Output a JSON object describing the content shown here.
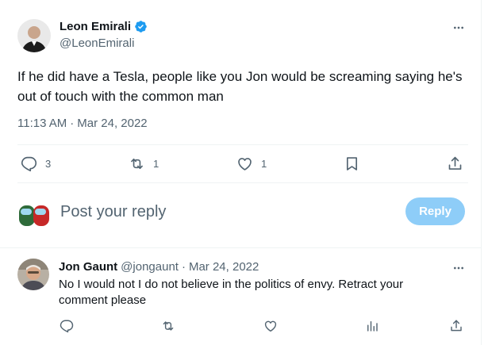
{
  "tweet": {
    "author_name": "Leon Emirali",
    "author_handle": "@LeonEmirali",
    "text": "If he did have a Tesla, people like you Jon would be screaming saying he's out of touch with the common man",
    "time": "11:13 AM",
    "date_sep": "·",
    "date": "Mar 24, 2022",
    "counts": {
      "replies": "3",
      "retweets": "1",
      "likes": "1"
    }
  },
  "composer": {
    "placeholder": "Post your reply",
    "button_label": "Reply"
  },
  "reply": {
    "author_name": "Jon Gaunt",
    "author_handle": "@jongaunt",
    "sep": "·",
    "date": "Mar 24, 2022",
    "text": "No I would not I do not believe in the politics of envy. Retract your comment please"
  },
  "colors": {
    "verified": "#1d9bf0",
    "reply_button_bg": "#8ecdf8",
    "secondary_text": "#536471",
    "divider": "#eff3f4"
  },
  "icons": [
    "more-icon",
    "verified-badge-icon",
    "reply-icon",
    "retweet-icon",
    "like-icon",
    "bookmark-icon",
    "share-icon",
    "views-icon"
  ]
}
